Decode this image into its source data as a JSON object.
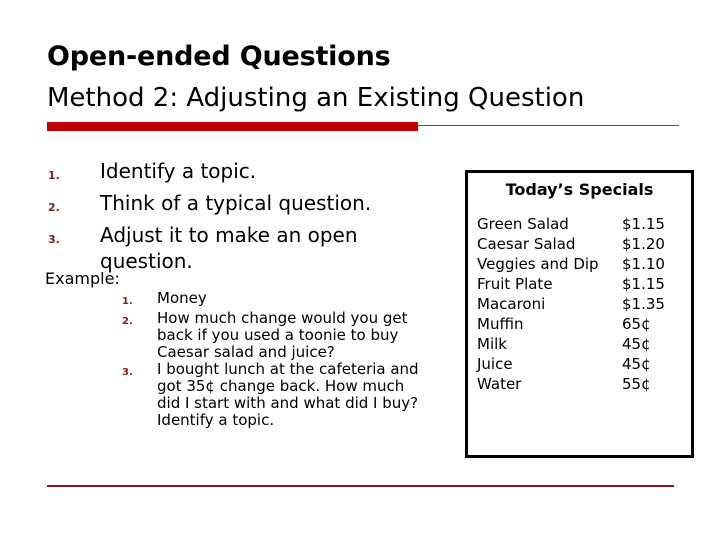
{
  "slide": {
    "title": "Open-ended Questions",
    "subtitle": "Method 2: Adjusting an Existing Question",
    "accent_color": "#c00000",
    "number_color": "#8b1a1a",
    "rule_color": "#7b1d1d"
  },
  "steps": [
    {
      "number": "1.",
      "text": "Identify a topic."
    },
    {
      "number": "2.",
      "text": "Think of a typical question."
    },
    {
      "number": "3.",
      "text": "Adjust it to make an open question."
    }
  ],
  "example": {
    "label": "Example:",
    "items": [
      {
        "number": "1.",
        "text": "Money"
      },
      {
        "number": "2.",
        "text": "How much change would you get back if you used a toonie to buy Caesar salad and juice?"
      },
      {
        "number": "3.",
        "text": "I bought lunch at the cafeteria and got 35¢ change back. How much did I start with and what did I buy? Identify a topic."
      }
    ]
  },
  "specials": {
    "title": "Today’s Specials",
    "items": [
      {
        "name": "Green Salad",
        "price": "$1.15"
      },
      {
        "name": "Caesar Salad",
        "price": "$1.20"
      },
      {
        "name": "Veggies and Dip",
        "price": "$1.10"
      },
      {
        "name": "Fruit Plate",
        "price": "$1.15"
      },
      {
        "name": "Macaroni",
        "price": "$1.35"
      },
      {
        "name": "Muffin",
        "price": "65¢"
      },
      {
        "name": "Milk",
        "price": "45¢"
      },
      {
        "name": "Juice",
        "price": "45¢"
      },
      {
        "name": "Water",
        "price": "55¢"
      }
    ]
  }
}
